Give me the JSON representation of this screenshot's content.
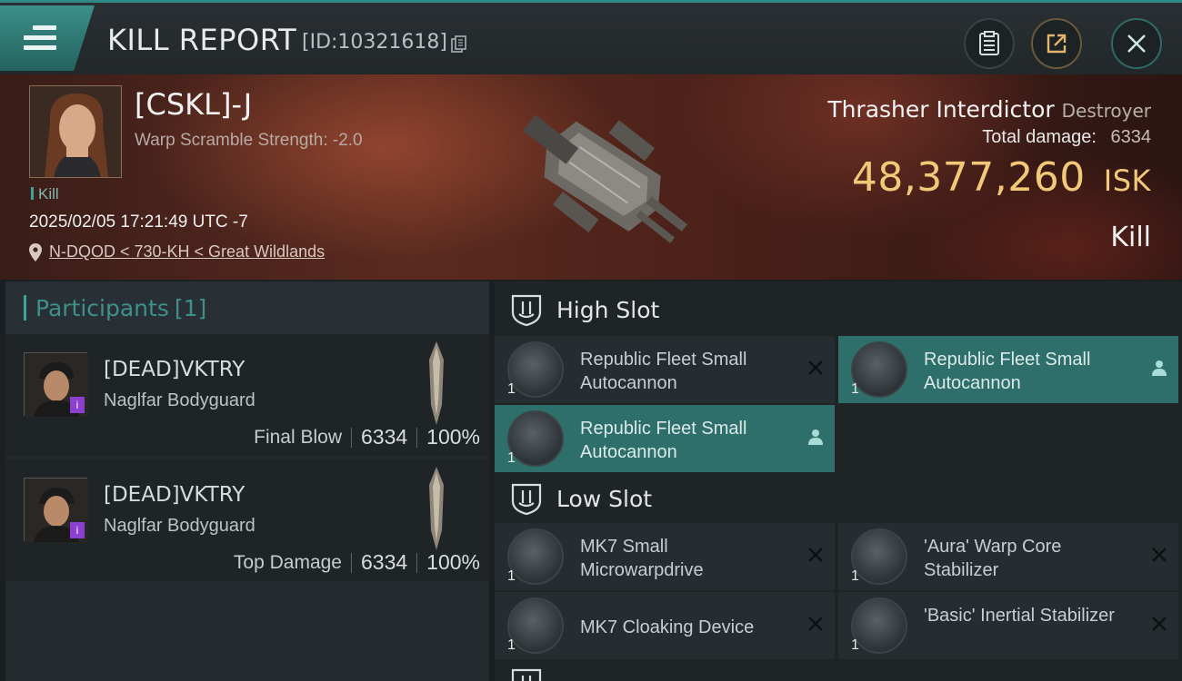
{
  "header": {
    "title": "KILL REPORT",
    "report_id": "[ID:10321618]"
  },
  "victim": {
    "name": "[CSKL]-J",
    "warp_scramble": "Warp Scramble Strength: -2.0",
    "tag": "Kill",
    "datetime": "2025/02/05 17:21:49 UTC -7",
    "location": "N-DQOD < 730-KH < Great Wildlands",
    "ship_name": "Thrasher Interdictor",
    "ship_class": "Destroyer",
    "total_damage_label": "Total damage:",
    "total_damage": "6334",
    "isk_value": "48,377,260",
    "isk_unit": "ISK",
    "result": "Kill"
  },
  "participants": {
    "label": "Participants",
    "count": "[1]",
    "list": [
      {
        "name": "[DEAD]VKTRY",
        "ship": "Naglfar Bodyguard",
        "role": "Final Blow",
        "damage": "6334",
        "percent": "100%"
      },
      {
        "name": "[DEAD]VKTRY",
        "ship": "Naglfar Bodyguard",
        "role": "Top Damage",
        "damage": "6334",
        "percent": "100%"
      }
    ]
  },
  "slots": {
    "high": {
      "label": "High Slot",
      "items": [
        {
          "name": "Republic Fleet Small Autocannon",
          "qty": "1",
          "status": "destroyed"
        },
        {
          "name": "Republic Fleet Small Autocannon",
          "qty": "1",
          "status": "dropped"
        },
        {
          "name": "Republic Fleet Small Autocannon",
          "qty": "1",
          "status": "dropped"
        }
      ]
    },
    "low": {
      "label": "Low Slot",
      "items": [
        {
          "name": "MK7 Small Microwarpdrive",
          "qty": "1",
          "status": "destroyed"
        },
        {
          "name": "'Aura' Warp Core Stabilizer",
          "qty": "1",
          "status": "destroyed"
        },
        {
          "name": "MK7 Cloaking Device",
          "qty": "1",
          "status": "destroyed"
        },
        {
          "name": "'Basic' Inertial Stabilizer",
          "qty": "1",
          "status": "destroyed"
        }
      ]
    }
  },
  "colors": {
    "accent_teal": "#2e6f6b",
    "isk_gold": "#f2c879",
    "purple_badge": "#8d3fd1"
  }
}
